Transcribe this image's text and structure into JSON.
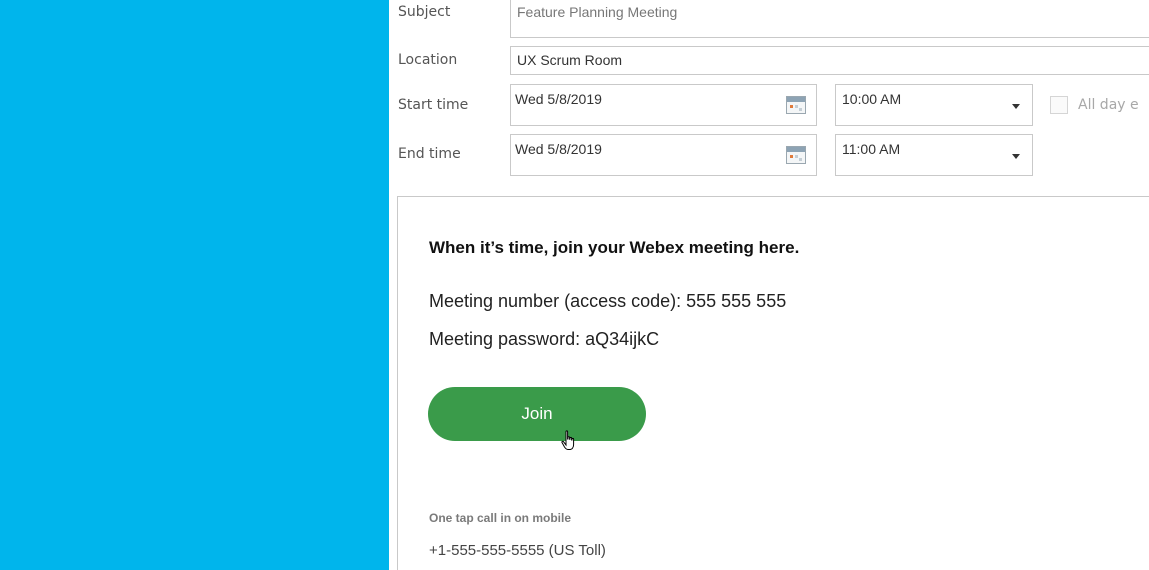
{
  "form": {
    "subject_label": "Subject",
    "subject_value": "Feature Planning Meeting",
    "location_label": "Location",
    "location_value": "UX Scrum Room",
    "start_label": "Start time",
    "start_date": "Wed 5/8/2019",
    "start_time": "10:00 AM",
    "end_label": "End time",
    "end_date": "Wed 5/8/2019",
    "end_time": "11:00 AM",
    "all_day_label": "All day e"
  },
  "body": {
    "heading": "When it’s time, join your Webex meeting here.",
    "meeting_number": "Meeting number (access code): 555 555 555",
    "meeting_password": "Meeting password: aQ34ijkC",
    "join_label": "Join",
    "one_tap_label": "One tap call in on mobile",
    "phone": "+1-555-555-5555 (US Toll)"
  },
  "colors": {
    "left_panel": "#00b5ec",
    "join_button": "#3a9b4a"
  }
}
